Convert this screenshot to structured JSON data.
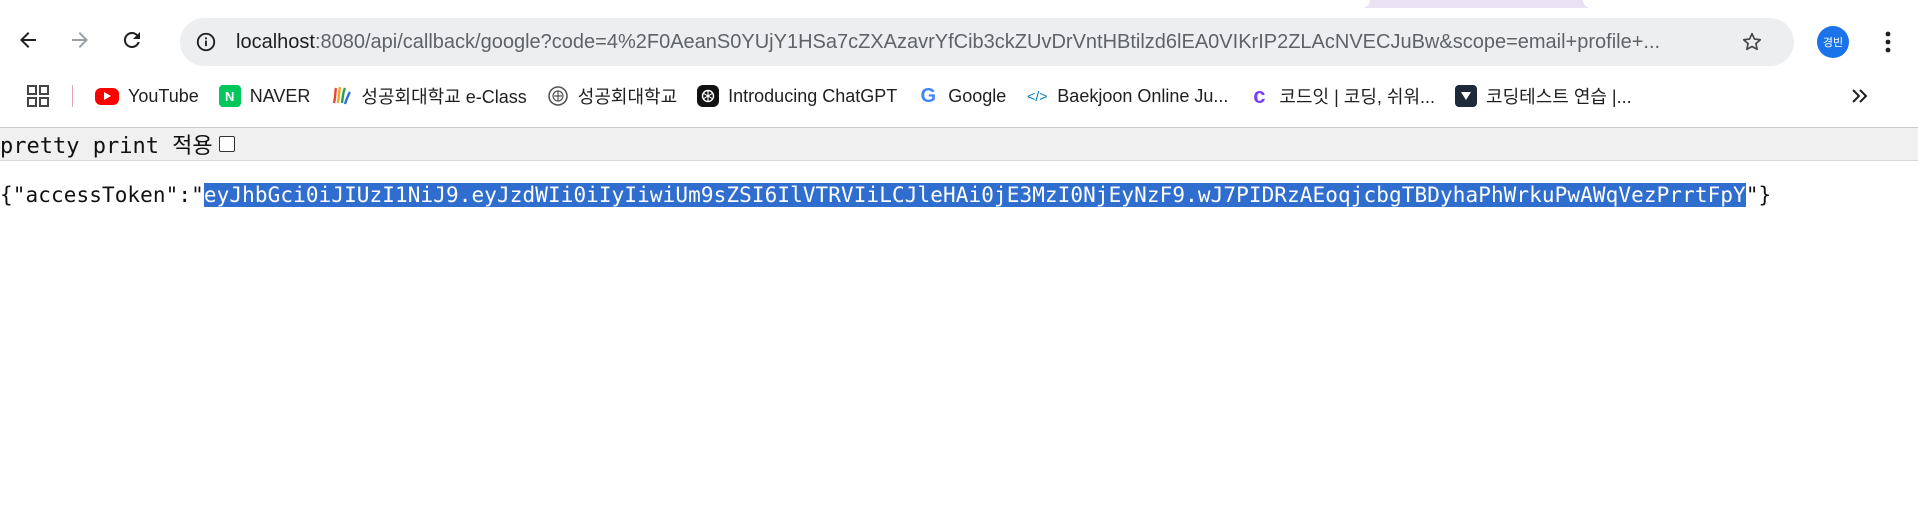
{
  "browser": {
    "url_host": "localhost",
    "url_rest": ":8080/api/callback/google?code=4%2F0AeanS0YUjY1HSa7cZXAzavrYfCib3ckZUvDrVntHBtilzd6lEA0VIKrIP2ZLAcNVECJuBw&scope=email+profile+...",
    "profile_label": "경빈",
    "colors": {
      "omnibox_bg": "#eceef0",
      "avatar_bg": "#1a73e8"
    }
  },
  "bookmarks": [
    {
      "label": "YouTube",
      "icon": "youtube-icon"
    },
    {
      "label": "NAVER",
      "icon": "naver-icon",
      "icon_text": "N"
    },
    {
      "label": "성공회대학교 e-Class",
      "icon": "eclass-icon"
    },
    {
      "label": "성공회대학교",
      "icon": "university-icon"
    },
    {
      "label": "Introducing ChatGPT",
      "icon": "chatgpt-icon"
    },
    {
      "label": "Google",
      "icon": "google-icon",
      "icon_text": "G"
    },
    {
      "label": "Baekjoon Online Ju...",
      "icon": "code-brackets-icon",
      "icon_text": "</>"
    },
    {
      "label": "코드잇 | 코딩, 쉬워...",
      "icon": "codeit-icon",
      "icon_text": "c"
    },
    {
      "label": "코딩테스트 연습 |...",
      "icon": "programmers-icon"
    }
  ],
  "page": {
    "pretty_print_label": "pretty print 적용",
    "json_prefix": "{\"accessToken\":\"",
    "token": "eyJhbGci0iJIUzI1NiJ9.eyJzdWIi0iIyIiwiUm9sZSI6IlVTRVIiLCJleHAi0jE3MzI0NjEyNzF9.wJ7PIDRzAEoqjcbgTBDyhaPhWrkuPwAWqVezPrrtFpY",
    "json_suffix": "\"}",
    "selection_color": "#2f6ecf"
  }
}
